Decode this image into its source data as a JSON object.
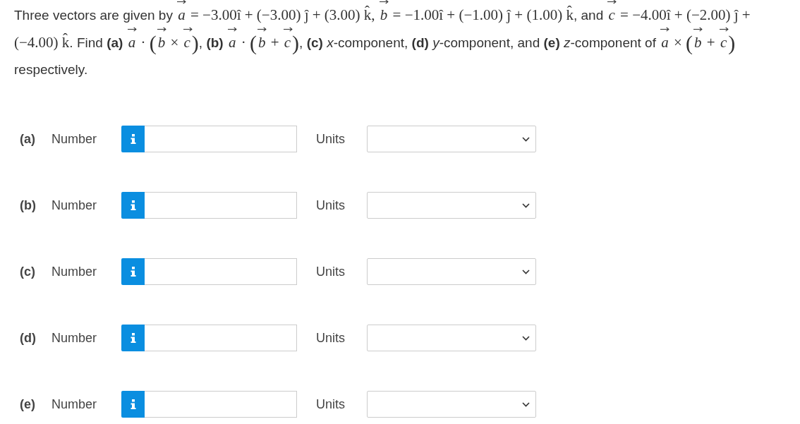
{
  "question": {
    "segments": [
      {
        "kind": "text",
        "text": "Three vectors are given by "
      },
      {
        "kind": "vec",
        "text": "a"
      },
      {
        "kind": "math",
        "text": " = −3.00î + (−3.00) ĵ + (3.00) k̂, "
      },
      {
        "kind": "vec",
        "text": "b"
      },
      {
        "kind": "math",
        "text": " = −1.00î + (−1.00) ĵ + (1.00) k̂"
      },
      {
        "kind": "text",
        "text": ", and "
      },
      {
        "kind": "vec",
        "text": "c"
      },
      {
        "kind": "math",
        "text": " = −4.00î + (−2.00) ĵ + (−4.00) k̂"
      },
      {
        "kind": "text",
        "text": ". Find "
      },
      {
        "kind": "bold",
        "text": "(a) "
      },
      {
        "kind": "vec",
        "text": "a"
      },
      {
        "kind": "math",
        "text": " · "
      },
      {
        "kind": "paren",
        "text": "("
      },
      {
        "kind": "vec",
        "text": "b"
      },
      {
        "kind": "math",
        "text": " × "
      },
      {
        "kind": "vec",
        "text": "c"
      },
      {
        "kind": "paren",
        "text": ")"
      },
      {
        "kind": "text",
        "text": ", "
      },
      {
        "kind": "bold",
        "text": "(b) "
      },
      {
        "kind": "vec",
        "text": "a"
      },
      {
        "kind": "math",
        "text": " · "
      },
      {
        "kind": "paren",
        "text": "("
      },
      {
        "kind": "vec",
        "text": "b"
      },
      {
        "kind": "math",
        "text": " + "
      },
      {
        "kind": "vec",
        "text": "c"
      },
      {
        "kind": "paren",
        "text": ")"
      },
      {
        "kind": "text",
        "text": ", "
      },
      {
        "kind": "bold",
        "text": "(c) "
      },
      {
        "kind": "italic",
        "text": "x"
      },
      {
        "kind": "text",
        "text": "-component, "
      },
      {
        "kind": "bold",
        "text": "(d) "
      },
      {
        "kind": "italic",
        "text": "y"
      },
      {
        "kind": "text",
        "text": "-component, and "
      },
      {
        "kind": "bold",
        "text": "(e) "
      },
      {
        "kind": "italic",
        "text": "z"
      },
      {
        "kind": "text",
        "text": "-component of "
      },
      {
        "kind": "vec",
        "text": "a"
      },
      {
        "kind": "math",
        "text": " × "
      },
      {
        "kind": "paren",
        "text": "("
      },
      {
        "kind": "vec",
        "text": "b"
      },
      {
        "kind": "math",
        "text": " + "
      },
      {
        "kind": "vec",
        "text": "c"
      },
      {
        "kind": "paren",
        "text": ")"
      },
      {
        "kind": "text",
        "text": " respectively."
      }
    ]
  },
  "parts": [
    {
      "label": "(a)",
      "number_label": "Number",
      "units_label": "Units"
    },
    {
      "label": "(b)",
      "number_label": "Number",
      "units_label": "Units"
    },
    {
      "label": "(c)",
      "number_label": "Number",
      "units_label": "Units"
    },
    {
      "label": "(d)",
      "number_label": "Number",
      "units_label": "Units"
    },
    {
      "label": "(e)",
      "number_label": "Number",
      "units_label": "Units"
    }
  ]
}
